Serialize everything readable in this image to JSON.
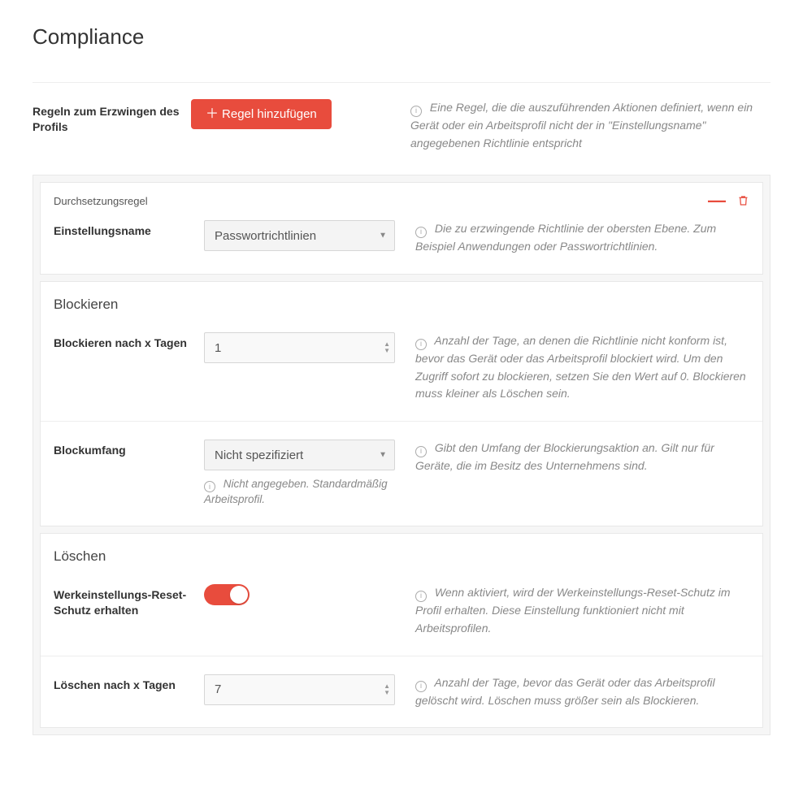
{
  "page": {
    "title": "Compliance"
  },
  "top": {
    "label": "Regeln zum Erzwingen des Profils",
    "add_button": "Regel hinzufügen",
    "help": "Eine Regel, die die auszuführenden Aktionen definiert, wenn ein Gerät oder ein Arbeitsprofil nicht der in \"Einstellungsname\" angegebenen Richtlinie entspricht"
  },
  "rule": {
    "header": "Durchsetzungsregel",
    "setting_name": {
      "label": "Einstellungsname",
      "value": "Passwortrichtlinien",
      "help": "Die zu erzwingende Richtlinie der obersten Ebene. Zum Beispiel Anwendungen oder Passwortrichtlinien."
    },
    "block": {
      "section": "Blockieren",
      "after_days": {
        "label": "Blockieren nach x Tagen",
        "value": "1",
        "help": "Anzahl der Tage, an denen die Richtlinie nicht konform ist, bevor das Gerät oder das Arbeitsprofil blockiert wird. Um den Zugriff sofort zu blockieren, setzen Sie den Wert auf 0. Blockieren muss kleiner als Löschen sein."
      },
      "scope": {
        "label": "Blockumfang",
        "value": "Nicht spezifiziert",
        "sub_help": "Nicht angegeben. Standardmäßig Arbeitsprofil.",
        "help": "Gibt den Umfang der Blockierungsaktion an. Gilt nur für Geräte, die im Besitz des Unternehmens sind."
      }
    },
    "wipe": {
      "section": "Löschen",
      "frp": {
        "label": "Werkeinstellungs-Reset-Schutz erhalten",
        "enabled": true,
        "help": "Wenn aktiviert, wird der Werkeinstellungs-Reset-Schutz im Profil erhalten. Diese Einstellung funktioniert nicht mit Arbeitsprofilen."
      },
      "after_days": {
        "label": "Löschen nach x Tagen",
        "value": "7",
        "help": "Anzahl der Tage, bevor das Gerät oder das Arbeitsprofil gelöscht wird. Löschen muss größer sein als Blockieren."
      }
    }
  }
}
